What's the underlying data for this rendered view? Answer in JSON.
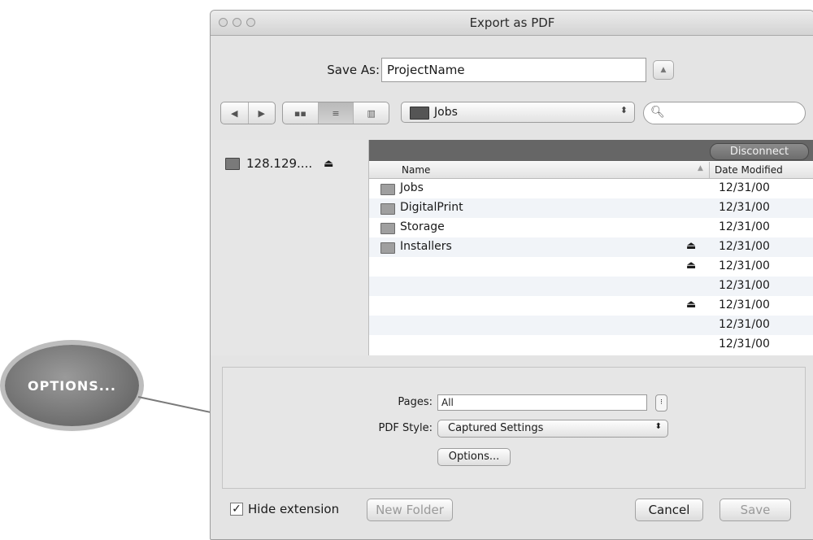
{
  "callout": {
    "label": "OPTIONS..."
  },
  "window": {
    "title": "Export as PDF"
  },
  "save_as": {
    "label": "Save As:",
    "value": "ProjectName"
  },
  "toolbar": {
    "location": "Jobs",
    "search_value": ""
  },
  "sidebar": {
    "items": [
      {
        "label": "128.129....",
        "icon": "monitor-icon",
        "ejectable": true
      }
    ]
  },
  "file_list": {
    "disconnect_label": "Disconnect",
    "columns": {
      "name": "Name",
      "date": "Date Modified"
    },
    "rows": [
      {
        "name": "Jobs",
        "date": "12/31/00",
        "folder": true,
        "eject": false
      },
      {
        "name": "DigitalPrint",
        "date": "12/31/00",
        "folder": true,
        "eject": false
      },
      {
        "name": "Storage",
        "date": "12/31/00",
        "folder": true,
        "eject": false
      },
      {
        "name": "Installers",
        "date": "12/31/00",
        "folder": true,
        "eject": true
      },
      {
        "name": "",
        "date": "12/31/00",
        "folder": false,
        "eject": true
      },
      {
        "name": "",
        "date": "12/31/00",
        "folder": false,
        "eject": false
      },
      {
        "name": "",
        "date": "12/31/00",
        "folder": false,
        "eject": true
      },
      {
        "name": "",
        "date": "12/31/00",
        "folder": false,
        "eject": false
      },
      {
        "name": "",
        "date": "12/31/00",
        "folder": false,
        "eject": false
      }
    ]
  },
  "options": {
    "pages_label": "Pages:",
    "pages_value": "All",
    "style_label": "PDF Style:",
    "style_value": "Captured Settings",
    "options_button": "Options..."
  },
  "bottom": {
    "hide_extension_label": "Hide extension",
    "hide_extension_checked": true,
    "new_folder": "New Folder",
    "cancel": "Cancel",
    "save": "Save"
  }
}
